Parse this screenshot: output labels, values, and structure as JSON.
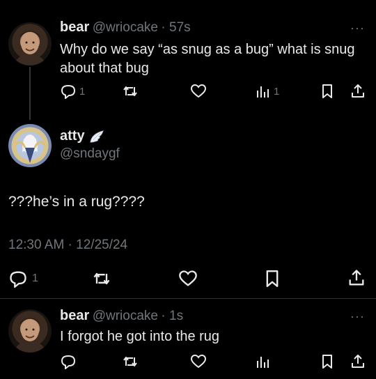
{
  "tweet1": {
    "name": "bear",
    "handle": "@wriocake",
    "time": "· 57s",
    "text": "Why do we say “as snug as a bug” what is snug about that bug",
    "reply_count": "1",
    "views_count": "1",
    "more": "···"
  },
  "main": {
    "name": "atty",
    "handle": "@sndaygf",
    "text": "???he’s in a rug????",
    "timestamp": "12:30 AM · 12/25/24",
    "reply_count": "1"
  },
  "tweet3": {
    "name": "bear",
    "handle": "@wriocake",
    "time": "· 1s",
    "text": "I forgot he got into the rug",
    "more": "···"
  },
  "icons": {
    "reply": "speech-bubble-icon",
    "retweet": "retweet-icon",
    "like": "heart-icon",
    "views": "bar-chart-icon",
    "bookmark": "bookmark-icon",
    "share": "share-icon",
    "badge": "angel-wing-icon"
  },
  "colors": {
    "background": "#000000",
    "text": "#e7e9ea",
    "muted": "#71767b",
    "divider": "#2f3336"
  }
}
